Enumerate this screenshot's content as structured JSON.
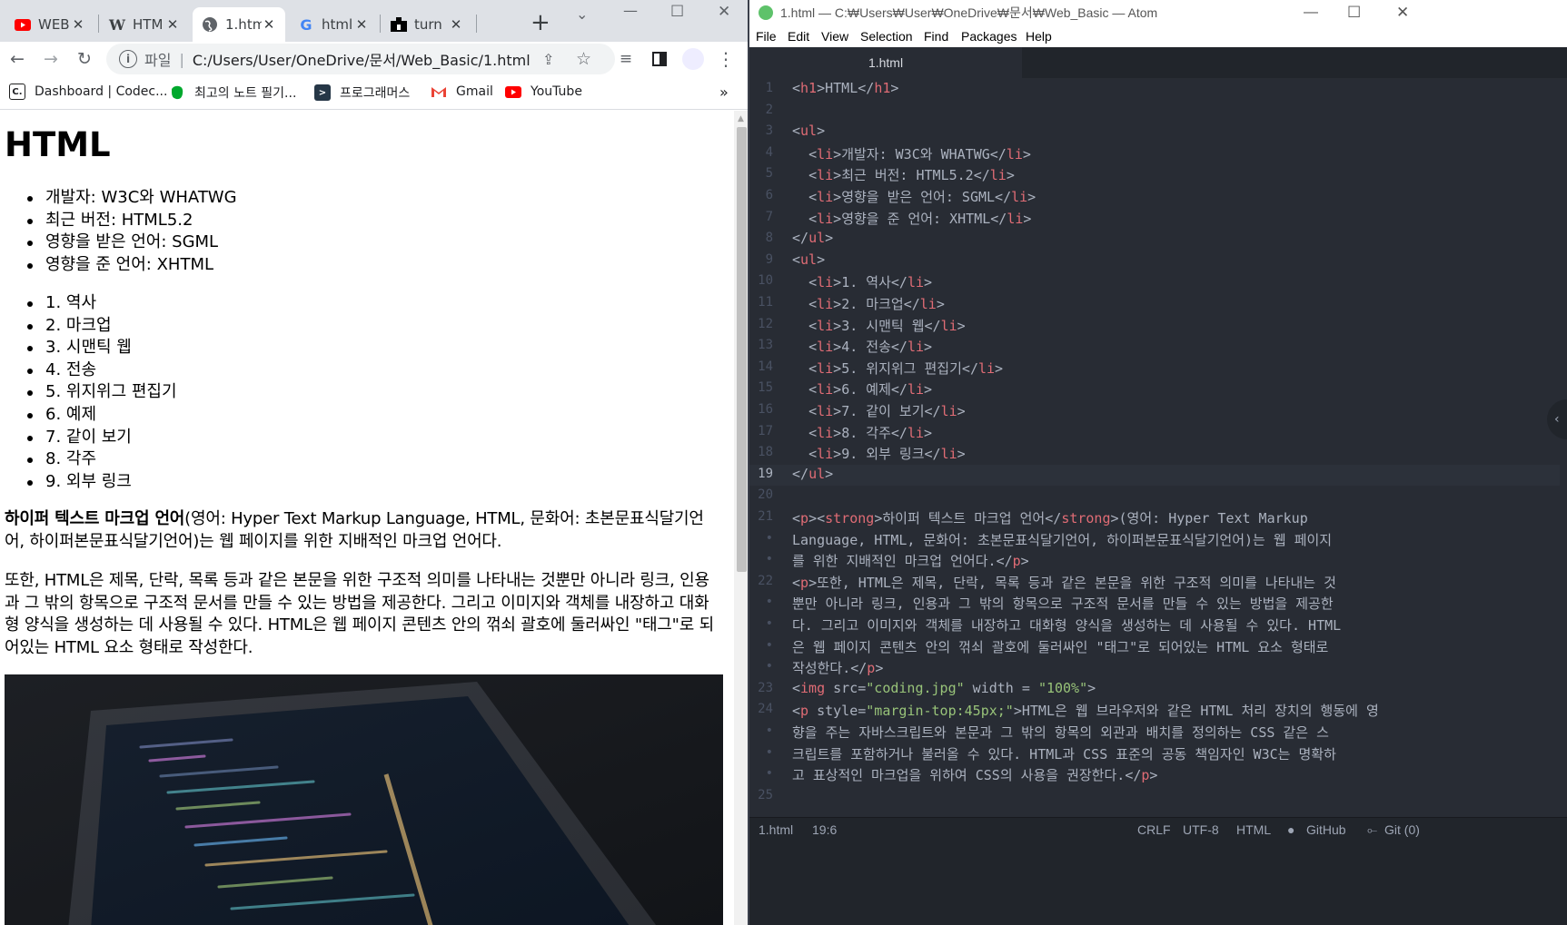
{
  "browser": {
    "tabs": [
      {
        "title": "WEB",
        "favicon": "youtube-icon",
        "color": "#ff0000"
      },
      {
        "title": "HTM",
        "favicon": "wikipedia-icon",
        "color": "#000000"
      },
      {
        "title": "1.htm",
        "favicon": "globe-icon",
        "color": "#5f6368"
      },
      {
        "title": "html",
        "favicon": "google-icon",
        "color": "#4285f4"
      },
      {
        "title": "turn",
        "favicon": "turnitin-icon",
        "color": "#000000"
      }
    ],
    "address_prefix": "파일",
    "address_url": "C:/Users/User/OneDrive/문서/Web_Basic/1.html",
    "bookmarks": [
      {
        "label": "Dashboard | Codec...",
        "icon": "codecademy-icon"
      },
      {
        "label": "최고의 노트 필기...",
        "icon": "evernote-icon"
      },
      {
        "label": "프로그래머스",
        "icon": "programmers-icon"
      },
      {
        "label": "Gmail",
        "icon": "gmail-icon"
      },
      {
        "label": "YouTube",
        "icon": "youtube-icon"
      }
    ],
    "bookmarks_more": "»"
  },
  "page": {
    "heading": "HTML",
    "list1": [
      "개발자: W3C와 WHATWG",
      "최근 버전: HTML5.2",
      "영향을 받은 언어: SGML",
      "영향을 준 언어: XHTML"
    ],
    "list2": [
      "1. 역사",
      "2. 마크업",
      "3. 시맨틱 웹",
      "4. 전송",
      "5. 위지위그 편집기",
      "6. 예제",
      "7. 같이 보기",
      "8. 각주",
      "9. 외부 링크"
    ],
    "p1_strong": "하이퍼 텍스트 마크업 언어",
    "p1_rest": "(영어: Hyper Text Markup Language, HTML, 문화어: 초본문표식달기언어, 하이퍼본문표식달기언어)는 웹 페이지를 위한 지배적인 마크업 언어다.",
    "p2": "또한, HTML은 제목, 단락, 목록 등과 같은 본문을 위한 구조적 의미를 나타내는 것뿐만 아니라 링크, 인용과 그 밖의 항목으로 구조적 문서를 만들 수 있는 방법을 제공한다. 그리고 이미지와 객체를 내장하고 대화형 양식을 생성하는 데 사용될 수 있다. HTML은 웹 페이지 콘텐츠 안의 꺾쇠 괄호에 둘러싸인 \"태그\"로 되어있는 HTML 요소 형태로 작성한다."
  },
  "atom": {
    "title": "1.html — C:₩Users₩User₩OneDrive₩문서₩Web_Basic — Atom",
    "menu": [
      "File",
      "Edit",
      "View",
      "Selection",
      "Find",
      "Packages",
      "Help"
    ],
    "tab": "1.html",
    "gutter": [
      "1",
      "2",
      "3",
      "4",
      "5",
      "6",
      "7",
      "8",
      "9",
      "10",
      "11",
      "12",
      "13",
      "14",
      "15",
      "16",
      "17",
      "18",
      "19",
      "20",
      "21",
      "•",
      "•",
      "22",
      "•",
      "•",
      "•",
      "•",
      "23",
      "24",
      "•",
      "•",
      "•",
      "25"
    ],
    "code": [
      "<h1>HTML</h1>",
      "",
      "<ul>",
      "  <li>개발자: W3C와 WHATWG</li>",
      "  <li>최근 버전: HTML5.2</li>",
      "  <li>영향을 받은 언어: SGML</li>",
      "  <li>영향을 준 언어: XHTML</li>",
      "</ul>",
      "<ul>",
      "  <li>1. 역사</li>",
      "  <li>2. 마크업</li>",
      "  <li>3. 시맨틱 웹</li>",
      "  <li>4. 전송</li>",
      "  <li>5. 위지위그 편집기</li>",
      "  <li>6. 예제</li>",
      "  <li>7. 같이 보기</li>",
      "  <li>8. 각주</li>",
      "  <li>9. 외부 링크</li>",
      "</ul>",
      "",
      "<p><strong>하이퍼 텍스트 마크업 언어</strong>(영어: Hyper Text Markup",
      "Language, HTML, 문화어: 초본문표식달기언어, 하이퍼본문표식달기언어)는 웹 페이지",
      "를 위한 지배적인 마크업 언어다.</p>",
      "<p>또한, HTML은 제목, 단락, 목록 등과 같은 본문을 위한 구조적 의미를 나타내는 것",
      "뿐만 아니라 링크, 인용과 그 밖의 항목으로 구조적 문서를 만들 수 있는 방법을 제공한",
      "다. 그리고 이미지와 객체를 내장하고 대화형 양식을 생성하는 데 사용될 수 있다. HTML",
      "은 웹 페이지 콘텐츠 안의 꺾쇠 괄호에 둘러싸인 \"태그\"로 되어있는 HTML 요소 형태로",
      "작성한다.</p>",
      "<img src=\"coding.jpg\" width = \"100%\">",
      "<p style=\"margin-top:45px;\">HTML은 웹 브라우저와 같은 HTML 처리 장치의 행동에 영",
      "향을 주는 자바스크립트와 본문과 그 밖의 항목의 외관과 배치를 정의하는 CSS 같은 스",
      "크립트를 포함하거나 불러올 수 있다. HTML과 CSS 표준의 공동 책임자인 W3C는 명확하",
      "고 표상적인 마크업을 위하여 CSS의 사용을 권장한다.</p>",
      ""
    ],
    "current_line_index": 18,
    "status": {
      "file": "1.html",
      "cursor": "19:6",
      "line_ending": "CRLF",
      "encoding": "UTF-8",
      "grammar": "HTML",
      "github": "GitHub",
      "git": "Git (0)"
    }
  }
}
